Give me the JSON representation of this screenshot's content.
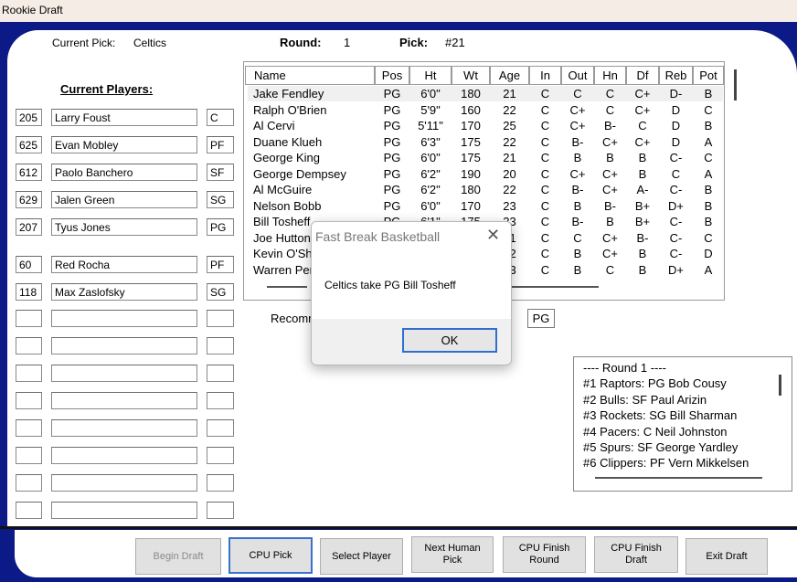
{
  "window": {
    "title": "Rookie Draft"
  },
  "header": {
    "current_pick_label": "Current Pick:",
    "current_pick_team": "Celtics",
    "round_label": "Round:",
    "round_value": "1",
    "pick_label": "Pick:",
    "pick_value": "#21"
  },
  "roster": {
    "heading": "Current Players:",
    "rows": [
      {
        "num": "205",
        "name": "Larry Foust",
        "pos": "C"
      },
      {
        "num": "625",
        "name": "Evan Mobley",
        "pos": "PF"
      },
      {
        "num": "612",
        "name": "Paolo Banchero",
        "pos": "SF"
      },
      {
        "num": "629",
        "name": "Jalen Green",
        "pos": "SG"
      },
      {
        "num": "207",
        "name": "Tyus Jones",
        "pos": "PG"
      },
      {
        "num": "60",
        "name": "Red Rocha",
        "pos": "PF"
      },
      {
        "num": "118",
        "name": "Max Zaslofsky",
        "pos": "SG"
      },
      {
        "num": "",
        "name": "",
        "pos": ""
      },
      {
        "num": "",
        "name": "",
        "pos": ""
      },
      {
        "num": "",
        "name": "",
        "pos": ""
      },
      {
        "num": "",
        "name": "",
        "pos": ""
      },
      {
        "num": "",
        "name": "",
        "pos": ""
      },
      {
        "num": "",
        "name": "",
        "pos": ""
      },
      {
        "num": "",
        "name": "",
        "pos": ""
      },
      {
        "num": "",
        "name": "",
        "pos": ""
      }
    ]
  },
  "prospects": {
    "columns": [
      "Name",
      "Pos",
      "Ht",
      "Wt",
      "Age",
      "In",
      "Out",
      "Hn",
      "Df",
      "Reb",
      "Pot"
    ],
    "rows": [
      [
        "Jake Fendley",
        "PG",
        "6'0\"",
        "180",
        "21",
        "C",
        "C",
        "C",
        "C+",
        "D-",
        "B"
      ],
      [
        "Ralph O'Brien",
        "PG",
        "5'9\"",
        "160",
        "22",
        "C",
        "C+",
        "C",
        "C+",
        "D",
        "C"
      ],
      [
        "Al Cervi",
        "PG",
        "5'11\"",
        "170",
        "25",
        "C",
        "C+",
        "B-",
        "C",
        "D",
        "B"
      ],
      [
        "Duane Klueh",
        "PG",
        "6'3\"",
        "175",
        "22",
        "C",
        "B-",
        "C+",
        "C+",
        "D",
        "A"
      ],
      [
        "George King",
        "PG",
        "6'0\"",
        "175",
        "21",
        "C",
        "B",
        "B",
        "B",
        "C-",
        "C"
      ],
      [
        "George Dempsey",
        "PG",
        "6'2\"",
        "190",
        "20",
        "C",
        "C+",
        "C+",
        "B",
        "C",
        "A"
      ],
      [
        "Al McGuire",
        "PG",
        "6'2\"",
        "180",
        "22",
        "C",
        "B-",
        "C+",
        "A-",
        "C-",
        "B"
      ],
      [
        "Nelson Bobb",
        "PG",
        "6'0\"",
        "170",
        "23",
        "C",
        "B",
        "B-",
        "B+",
        "D+",
        "B"
      ],
      [
        "Bill Tosheff",
        "PG",
        "6'1\"",
        "175",
        "23",
        "C",
        "B-",
        "B",
        "B+",
        "C-",
        "B"
      ],
      [
        "Joe Hutton",
        "",
        "",
        "",
        "21",
        "C",
        "C",
        "C+",
        "B-",
        "C-",
        "C"
      ],
      [
        "Kevin O'Shea",
        "",
        "",
        "",
        "22",
        "C",
        "B",
        "C+",
        "B",
        "C-",
        "D"
      ],
      [
        "Warren Perkins",
        "",
        "",
        "",
        "23",
        "C",
        "B",
        "C",
        "B",
        "D+",
        "A"
      ]
    ]
  },
  "recommend": {
    "label": "Recommended Position:",
    "pos_button": "PG"
  },
  "draft_log": {
    "lines": [
      "---- Round 1 ----",
      "#1 Raptors: PG Bob Cousy",
      "#2 Bulls: SF Paul Arizin",
      "#3 Rockets: SG Bill Sharman",
      "#4 Pacers: C Neil Johnston",
      "#5 Spurs: SF George Yardley",
      "#6 Clippers: PF Vern Mikkelsen"
    ]
  },
  "buttons": {
    "begin_draft": "Begin Draft",
    "cpu_pick": "CPU Pick",
    "select_player": "Select Player",
    "next_human_pick_1": "Next Human",
    "next_human_pick_2": "Pick",
    "cpu_finish_round_1": "CPU Finish",
    "cpu_finish_round_2": "Round",
    "cpu_finish_draft_1": "CPU Finish",
    "cpu_finish_draft_2": "Draft",
    "exit_draft": "Exit Draft"
  },
  "dialog": {
    "title": "Fast Break Basketball",
    "message": "Celtics take PG Bill Tosheff",
    "ok": "OK"
  }
}
